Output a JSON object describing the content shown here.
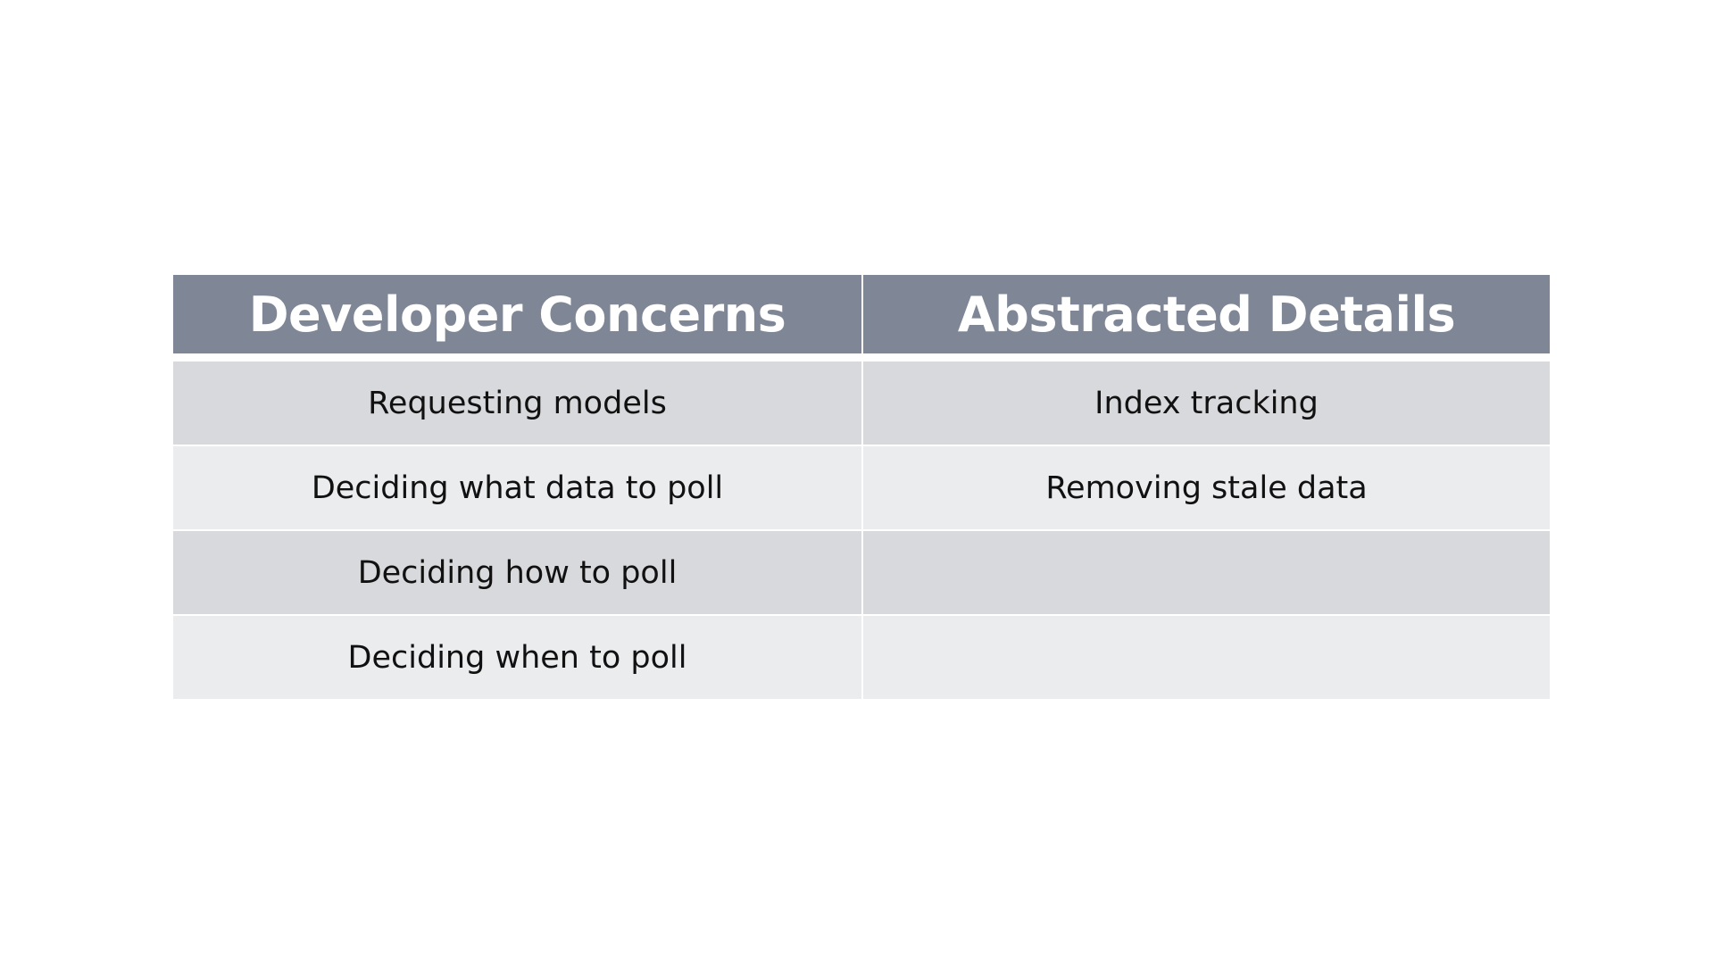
{
  "table": {
    "headers": [
      "Developer Concerns",
      "Abstracted Details"
    ],
    "rows": [
      [
        "Requesting models",
        "Index tracking"
      ],
      [
        "Deciding what data to poll",
        "Removing stale data"
      ],
      [
        "Deciding how to poll",
        ""
      ],
      [
        "Deciding when to poll",
        ""
      ]
    ]
  },
  "colors": {
    "header_bg": "#7f8796",
    "row_dark": "#d8d9dc",
    "row_light": "#ebecee"
  }
}
